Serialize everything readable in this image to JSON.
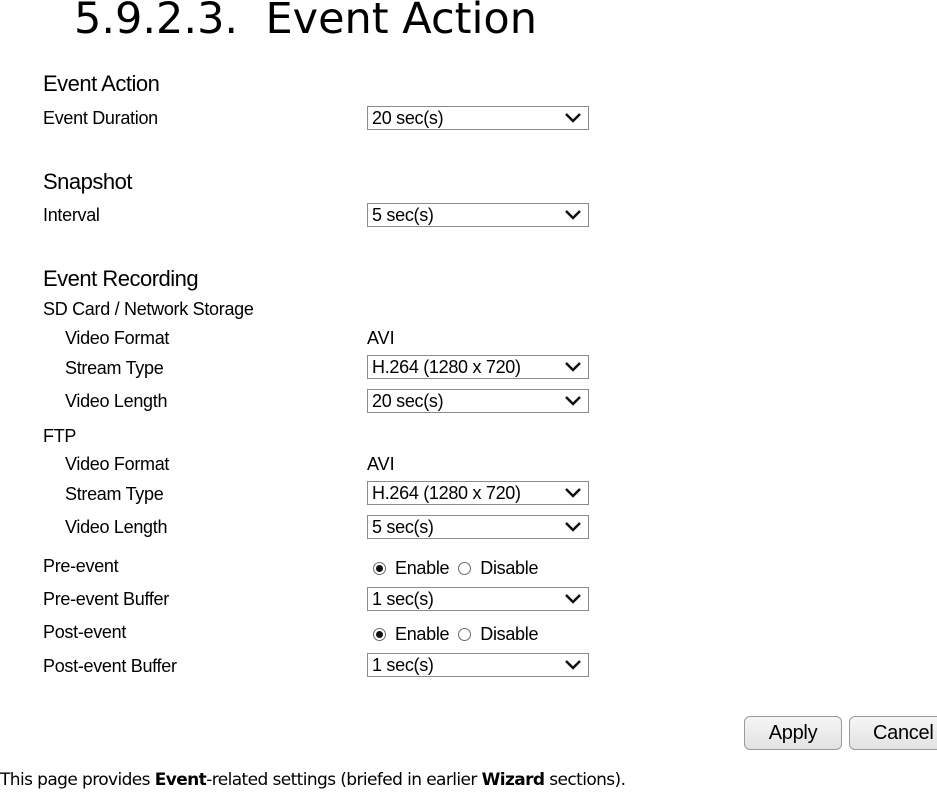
{
  "doc": {
    "heading_number": "5.9.2.3.",
    "heading_title": "Event Action",
    "caption": {
      "part1": "This page provides ",
      "bold1": "Event",
      "part2": "-related settings (briefed in earlier ",
      "bold2": "Wizard",
      "part3": " sections)."
    }
  },
  "form": {
    "event_action": {
      "title": "Event Action",
      "event_duration_label": "Event Duration",
      "event_duration_value": "20 sec(s)"
    },
    "snapshot": {
      "title": "Snapshot",
      "interval_label": "Interval",
      "interval_value": "5 sec(s)"
    },
    "event_recording": {
      "title": "Event Recording",
      "sd_card": {
        "title": "SD Card / Network Storage",
        "video_format_label": "Video Format",
        "video_format_value": "AVI",
        "stream_type_label": "Stream Type",
        "stream_type_value": "H.264 (1280 x 720)",
        "video_length_label": "Video Length",
        "video_length_value": "20 sec(s)"
      },
      "ftp": {
        "title": "FTP",
        "video_format_label": "Video Format",
        "video_format_value": "AVI",
        "stream_type_label": "Stream Type",
        "stream_type_value": "H.264 (1280 x 720)",
        "video_length_label": "Video Length",
        "video_length_value": "5 sec(s)"
      },
      "pre_event": {
        "label": "Pre-event",
        "enable_label": "Enable",
        "disable_label": "Disable",
        "selected": "Enable"
      },
      "pre_event_buffer": {
        "label": "Pre-event Buffer",
        "value": "1 sec(s)"
      },
      "post_event": {
        "label": "Post-event",
        "enable_label": "Enable",
        "disable_label": "Disable",
        "selected": "Enable"
      },
      "post_event_buffer": {
        "label": "Post-event Buffer",
        "value": "1 sec(s)"
      }
    },
    "buttons": {
      "apply": "Apply",
      "cancel": "Cancel"
    }
  }
}
